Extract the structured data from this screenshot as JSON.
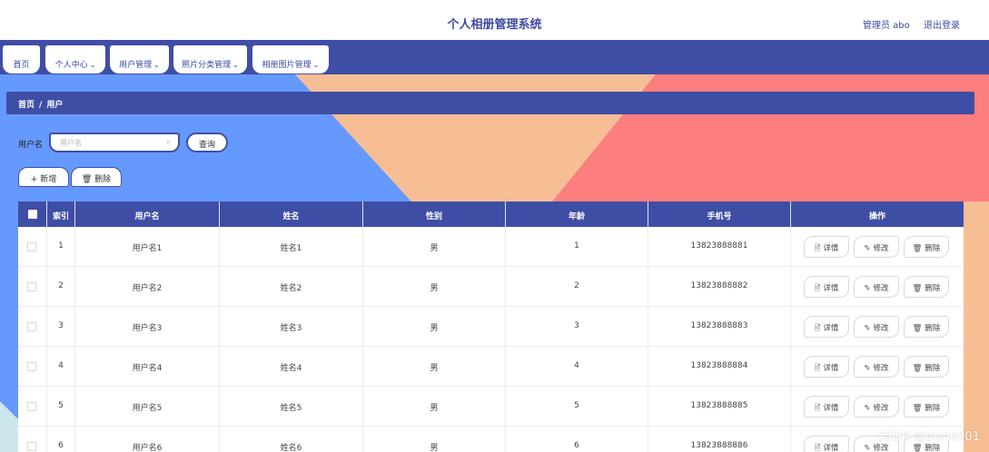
{
  "header": {
    "title": "个人相册管理系统",
    "admin": "管理员 abo",
    "logout": "退出登录"
  },
  "nav": [
    {
      "label": "首页",
      "chevron": ""
    },
    {
      "label": "个人中心",
      "chevron": "⌄"
    },
    {
      "label": "用户管理",
      "chevron": "⌄"
    },
    {
      "label": "照片分类管理",
      "chevron": "⌄"
    },
    {
      "label": "相册图片管理",
      "chevron": "⌄"
    }
  ],
  "breadcrumb": {
    "home": "首页",
    "separator": "/",
    "current": "用户"
  },
  "search": {
    "label": "用户名",
    "placeholder": "用户名",
    "value": "",
    "button": "查询"
  },
  "actions": {
    "add": "新增",
    "delete": "删除"
  },
  "icons": {
    "search": "search-icon",
    "add": "plus-icon",
    "delete": "trash-icon",
    "detail": "document-icon",
    "edit": "pencil-icon",
    "row_delete": "trash-icon"
  },
  "table": {
    "columns": [
      "索引",
      "用户名",
      "姓名",
      "性别",
      "年龄",
      "手机号",
      "操作"
    ],
    "ops": {
      "detail": "详情",
      "edit": "修改",
      "delete": "删除"
    },
    "rows": [
      {
        "index": "1",
        "username": "用户名1",
        "name": "姓名1",
        "gender": "男",
        "age": "1",
        "phone": "13823888881"
      },
      {
        "index": "2",
        "username": "用户名2",
        "name": "姓名2",
        "gender": "男",
        "age": "2",
        "phone": "13823888882"
      },
      {
        "index": "3",
        "username": "用户名3",
        "name": "姓名3",
        "gender": "男",
        "age": "3",
        "phone": "13823888883"
      },
      {
        "index": "4",
        "username": "用户名4",
        "name": "姓名4",
        "gender": "男",
        "age": "4",
        "phone": "13823888884"
      },
      {
        "index": "5",
        "username": "用户名5",
        "name": "姓名5",
        "gender": "男",
        "age": "5",
        "phone": "13823888885"
      },
      {
        "index": "6",
        "username": "用户名6",
        "name": "姓名6",
        "gender": "男",
        "age": "6",
        "phone": "13823888886"
      }
    ]
  },
  "watermark": "CSDN @bishe901",
  "colors": {
    "primary": "#3f4ea5",
    "bg_blue": "#6699ff",
    "bg_peach": "#f7be96",
    "bg_coral": "#fd7e7e"
  }
}
